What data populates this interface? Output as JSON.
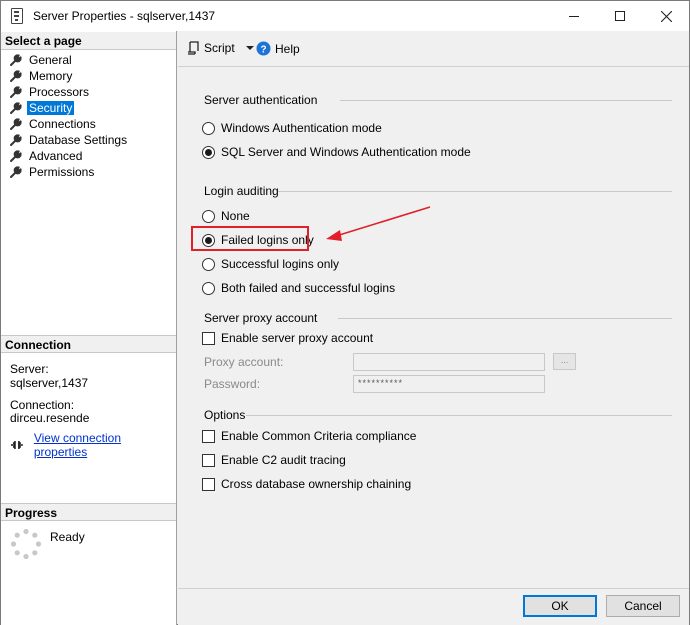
{
  "window": {
    "title": "Server Properties - sqlserver,1437"
  },
  "left": {
    "pages_header": "Select a page",
    "pages": [
      {
        "label": "General",
        "selected": false
      },
      {
        "label": "Memory",
        "selected": false
      },
      {
        "label": "Processors",
        "selected": false
      },
      {
        "label": "Security",
        "selected": true
      },
      {
        "label": "Connections",
        "selected": false
      },
      {
        "label": "Database Settings",
        "selected": false
      },
      {
        "label": "Advanced",
        "selected": false
      },
      {
        "label": "Permissions",
        "selected": false
      }
    ],
    "connection_header": "Connection",
    "server_label": "Server:",
    "server_value": "sqlserver,1437",
    "connection_label": "Connection:",
    "connection_value": "dirceu.resende",
    "view_link": "View connection properties",
    "progress_header": "Progress",
    "progress_status": "Ready"
  },
  "toolbar": {
    "script_label": "Script",
    "help_label": "Help"
  },
  "server_auth": {
    "title": "Server authentication",
    "options": [
      {
        "label": "Windows Authentication mode",
        "checked": false
      },
      {
        "label": "SQL Server and Windows Authentication mode",
        "checked": true
      }
    ]
  },
  "login_auditing": {
    "title": "Login auditing",
    "options": [
      {
        "label": "None",
        "checked": false
      },
      {
        "label": "Failed logins only",
        "checked": true
      },
      {
        "label": "Successful logins only",
        "checked": false
      },
      {
        "label": "Both failed and successful logins",
        "checked": false
      }
    ]
  },
  "proxy": {
    "title": "Server proxy account",
    "enable_label": "Enable server proxy account",
    "enable_checked": false,
    "account_label": "Proxy account:",
    "account_value": "",
    "password_label": "Password:",
    "password_value": "**********",
    "browse_label": "..."
  },
  "options": {
    "title": "Options",
    "items": [
      {
        "label": "Enable Common Criteria compliance",
        "checked": false
      },
      {
        "label": "Enable C2 audit tracing",
        "checked": false
      },
      {
        "label": "Cross database ownership chaining",
        "checked": false
      }
    ]
  },
  "buttons": {
    "ok": "OK",
    "cancel": "Cancel"
  },
  "colors": {
    "accent": "#0078d7",
    "highlight": "#e0202a",
    "link": "#0033cc"
  }
}
